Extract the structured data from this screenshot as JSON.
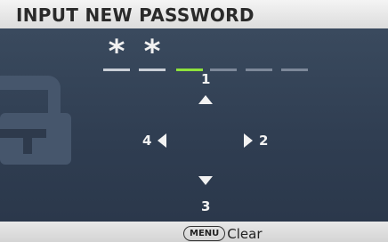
{
  "header": {
    "title": "INPUT NEW PASSWORD"
  },
  "password": {
    "length": 6,
    "entered_count": 2,
    "mask_char": "*",
    "active_slot": 3
  },
  "directions": {
    "up": "1",
    "right": "2",
    "down": "3",
    "left": "4"
  },
  "footer": {
    "menu_key": "MENU",
    "action_label": "Clear"
  },
  "colors": {
    "panel": "#2e3a4c",
    "active_slot": "#8ee23c",
    "text": "#f2f2f2"
  },
  "icons": [
    "lock-icon",
    "up-arrow-icon",
    "right-arrow-icon",
    "down-arrow-icon",
    "left-arrow-icon"
  ]
}
